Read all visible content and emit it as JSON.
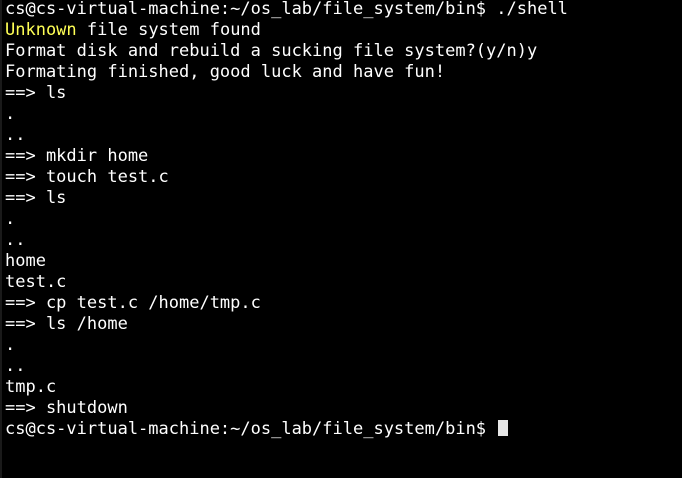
{
  "terminal": {
    "lines": [
      "cs@cs-virtual-machine:~/os_lab/file_system/bin$ ./shell",
      "file system found",
      "Format disk and rebuild a sucking file system?(y/n)y",
      "Formating finished, good luck and have fun!",
      "==> ls",
      ".",
      "..",
      "==> mkdir home",
      "==> touch test.c",
      "==> ls",
      ".",
      "..",
      "home",
      "test.c",
      "==> cp test.c /home/tmp.c",
      "==> ls /home",
      ".",
      "..",
      "tmp.c",
      "==> shutdown",
      "cs@cs-virtual-machine:~/os_lab/file_system/bin$ "
    ],
    "warning_word": "Unknown",
    "colors": {
      "background": "#000000",
      "text": "#ffffff",
      "warning": "#ffff55",
      "cursor": "#e6e6e6"
    }
  }
}
